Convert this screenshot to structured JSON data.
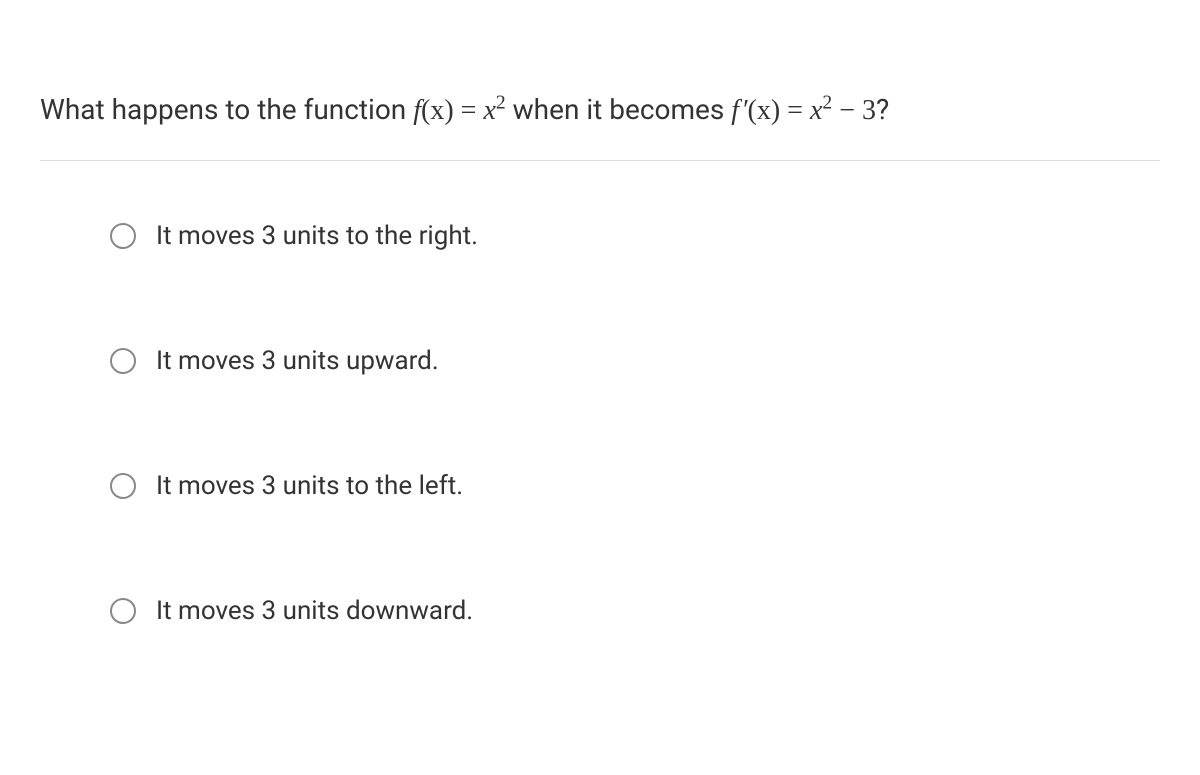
{
  "question": {
    "prefix": "What happens to the function ",
    "func1_name": "f",
    "func1_arg": "(x)",
    "func1_eq": " = ",
    "func1_var": "x",
    "func1_exp": "2",
    "mid": " when it becomes ",
    "func2_name": "f ′",
    "func2_arg": "(x)",
    "func2_eq": " = ",
    "func2_var": "x",
    "func2_exp": "2",
    "func2_tail": " − 3",
    "suffix": "?"
  },
  "options": [
    {
      "label": "It moves 3 units to the right."
    },
    {
      "label": "It moves 3 units upward."
    },
    {
      "label": "It moves 3 units to the left."
    },
    {
      "label": "It moves 3 units downward."
    }
  ]
}
